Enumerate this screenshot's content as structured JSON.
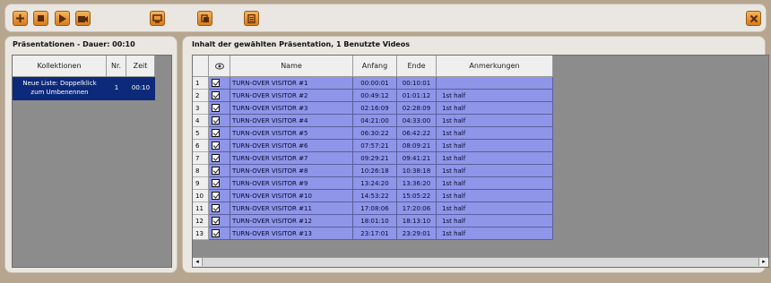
{
  "toolbar": {
    "buttons": [
      {
        "name": "add-button",
        "icon": "plus-icon"
      },
      {
        "name": "stop-button",
        "icon": "stop-icon"
      },
      {
        "name": "play-button",
        "icon": "play-icon"
      },
      {
        "name": "videos-button",
        "icon": "video-icon"
      },
      {
        "name": "monitor-button",
        "icon": "monitor-icon"
      },
      {
        "name": "copy-button",
        "icon": "copy-icon"
      },
      {
        "name": "document-button",
        "icon": "document-icon"
      }
    ],
    "close_icon": "close-icon"
  },
  "left_panel": {
    "title": "Präsentationen - Dauer: 00:10",
    "headers": {
      "collections": "Kollektionen",
      "nr": "Nr.",
      "time": "Zeit"
    },
    "rows": [
      {
        "name_line1": "Neue Liste: Doppelklick",
        "name_line2": "zum Umbenennen",
        "nr": "1",
        "time": "00:10"
      }
    ]
  },
  "right_panel": {
    "title": "Inhalt der gewählten Präsentation, 1 Benutzte Videos",
    "headers": {
      "visible_icon": "eye-icon",
      "name": "Name",
      "start": "Anfang",
      "end": "Ende",
      "notes": "Anmerkungen"
    },
    "rows": [
      {
        "n": "1",
        "name": "TURN-OVER VISITOR #1",
        "start": "00:00:01",
        "end": "00:10:01",
        "note": ""
      },
      {
        "n": "2",
        "name": "TURN-OVER VISITOR #2",
        "start": "00:49:12",
        "end": "01:01:12",
        "note": "1st half"
      },
      {
        "n": "3",
        "name": "TURN-OVER VISITOR #3",
        "start": "02:16:09",
        "end": "02:28:09",
        "note": "1st half"
      },
      {
        "n": "4",
        "name": "TURN-OVER VISITOR #4",
        "start": "04:21:00",
        "end": "04:33:00",
        "note": "1st half"
      },
      {
        "n": "5",
        "name": "TURN-OVER VISITOR #5",
        "start": "06:30:22",
        "end": "06:42:22",
        "note": "1st half"
      },
      {
        "n": "6",
        "name": "TURN-OVER VISITOR #6",
        "start": "07:57:21",
        "end": "08:09:21",
        "note": "1st half"
      },
      {
        "n": "7",
        "name": "TURN-OVER VISITOR #7",
        "start": "09:29:21",
        "end": "09:41:21",
        "note": "1st half"
      },
      {
        "n": "8",
        "name": "TURN-OVER VISITOR #8",
        "start": "10:26:18",
        "end": "10:38:18",
        "note": "1st half"
      },
      {
        "n": "9",
        "name": "TURN-OVER VISITOR #9",
        "start": "13:24:20",
        "end": "13:36:20",
        "note": "1st half"
      },
      {
        "n": "10",
        "name": "TURN-OVER VISITOR #10",
        "start": "14:53:22",
        "end": "15:05:22",
        "note": "1st half"
      },
      {
        "n": "11",
        "name": "TURN-OVER VISITOR #11",
        "start": "17:08:06",
        "end": "17:20:06",
        "note": "1st half"
      },
      {
        "n": "12",
        "name": "TURN-OVER VISITOR #12",
        "start": "18:01:10",
        "end": "18:13:10",
        "note": "1st half"
      },
      {
        "n": "13",
        "name": "TURN-OVER VISITOR #13",
        "start": "23:17:01",
        "end": "23:29:01",
        "note": "1st half"
      }
    ]
  },
  "colors": {
    "row_highlight": "#8f95e8",
    "accent": "#e08a2c"
  }
}
